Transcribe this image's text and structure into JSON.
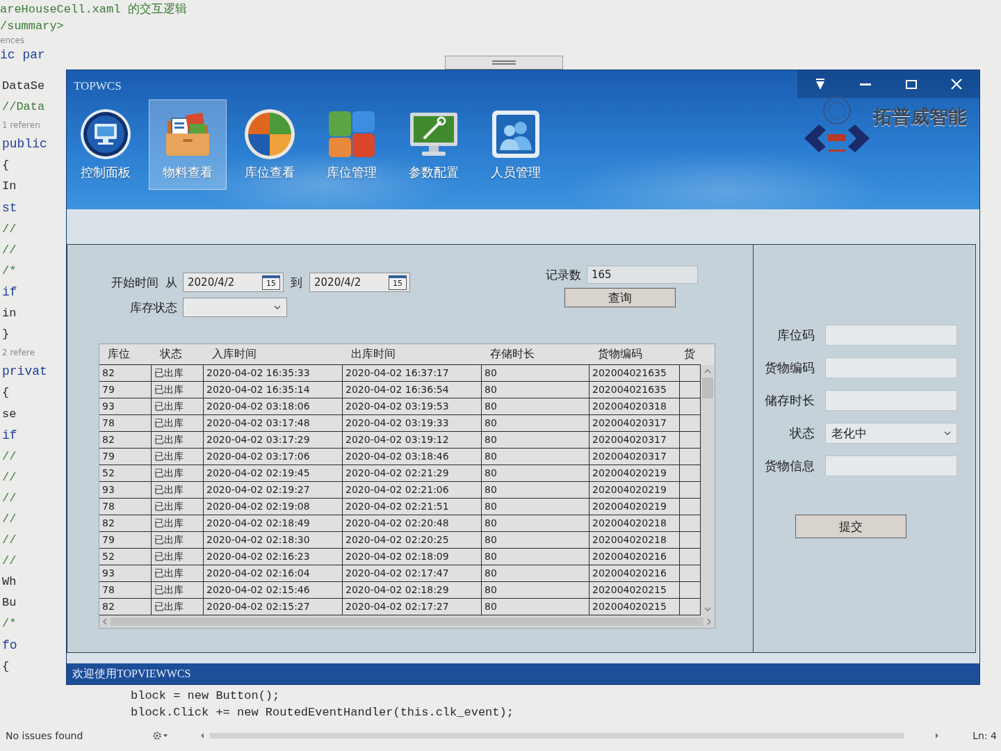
{
  "editor": {
    "top_lines": [
      {
        "kind": "comment",
        "text": "areHouseCell.xaml 的交互逻辑"
      },
      {
        "kind": "comment",
        "text": "/summary>"
      },
      {
        "kind": "ref",
        "text": "ences"
      },
      {
        "kind": "keyword",
        "text": "ic par"
      }
    ],
    "side_lines": [
      {
        "kind": "code",
        "text": "DataSe"
      },
      {
        "kind": "comment",
        "text": "//Data"
      },
      {
        "kind": "ref",
        "text": "1 referen"
      },
      {
        "kind": "keyword",
        "text": "public"
      },
      {
        "kind": "code",
        "text": "{"
      },
      {
        "kind": "code",
        "text": "In"
      },
      {
        "kind": "keyword",
        "text": "st"
      },
      {
        "kind": "comment",
        "text": "//"
      },
      {
        "kind": "comment",
        "text": "//"
      },
      {
        "kind": "comment",
        "text": "/*"
      },
      {
        "kind": "keyword",
        "text": "if"
      },
      {
        "kind": "code",
        "text": "in"
      },
      {
        "kind": "code",
        "text": "}"
      },
      {
        "kind": "ref",
        "text": "2 refere"
      },
      {
        "kind": "keyword",
        "text": "privat"
      },
      {
        "kind": "code",
        "text": "{"
      },
      {
        "kind": "code",
        "text": "se"
      },
      {
        "kind": "keyword",
        "text": "if"
      },
      {
        "kind": "comment",
        "text": "//"
      },
      {
        "kind": "comment",
        "text": "//"
      },
      {
        "kind": "comment",
        "text": "//"
      },
      {
        "kind": "comment",
        "text": "//"
      },
      {
        "kind": "comment",
        "text": "//"
      },
      {
        "kind": "comment",
        "text": "//"
      },
      {
        "kind": "code",
        "text": "Wh"
      },
      {
        "kind": "code",
        "text": "Bu"
      },
      {
        "kind": "comment",
        "text": "/*"
      },
      {
        "kind": "keyword",
        "text": "fo"
      },
      {
        "kind": "code",
        "text": "{"
      }
    ],
    "bottom_lines": [
      {
        "kind": "code",
        "text": "block = new Button();"
      },
      {
        "kind": "code",
        "text": "block.Click += new RoutedEventHandler(this.clk_event);"
      }
    ],
    "status": {
      "message": "No issues found",
      "position": "Ln: 4"
    }
  },
  "window": {
    "title": "TOPWCS",
    "nav": [
      {
        "label": "控制面板",
        "selected": false
      },
      {
        "label": "物料查看",
        "selected": true
      },
      {
        "label": "库位查看",
        "selected": false
      },
      {
        "label": "库位管理",
        "selected": false
      },
      {
        "label": "参数配置",
        "selected": false
      },
      {
        "label": "人员管理",
        "selected": false
      }
    ],
    "logo_text": "拓普威智能"
  },
  "filter": {
    "start_label": "开始时间",
    "from_label": "从",
    "from_date": {
      "value": "2020/4/2",
      "calendar_day": "15"
    },
    "to_label": "到",
    "to_date": {
      "value": "2020/4/2",
      "calendar_day": "15"
    },
    "status_label": "库存状态",
    "count_label": "记录数",
    "count_value": "165",
    "query_button": "查询"
  },
  "table": {
    "columns": [
      "库位",
      "状态",
      "入库时间",
      "出库时间",
      "存储时长",
      "货物编码",
      "货"
    ],
    "rows": [
      [
        "82",
        "已出库",
        "2020-04-02 16:35:33",
        "2020-04-02 16:37:17",
        "80",
        "202004021635"
      ],
      [
        "79",
        "已出库",
        "2020-04-02 16:35:14",
        "2020-04-02 16:36:54",
        "80",
        "202004021635"
      ],
      [
        "93",
        "已出库",
        "2020-04-02 03:18:06",
        "2020-04-02 03:19:53",
        "80",
        "202004020318"
      ],
      [
        "78",
        "已出库",
        "2020-04-02 03:17:48",
        "2020-04-02 03:19:33",
        "80",
        "202004020317"
      ],
      [
        "82",
        "已出库",
        "2020-04-02 03:17:29",
        "2020-04-02 03:19:12",
        "80",
        "202004020317"
      ],
      [
        "79",
        "已出库",
        "2020-04-02 03:17:06",
        "2020-04-02 03:18:46",
        "80",
        "202004020317"
      ],
      [
        "52",
        "已出库",
        "2020-04-02 02:19:45",
        "2020-04-02 02:21:29",
        "80",
        "202004020219"
      ],
      [
        "93",
        "已出库",
        "2020-04-02 02:19:27",
        "2020-04-02 02:21:06",
        "80",
        "202004020219"
      ],
      [
        "78",
        "已出库",
        "2020-04-02 02:19:08",
        "2020-04-02 02:21:51",
        "80",
        "202004020219"
      ],
      [
        "82",
        "已出库",
        "2020-04-02 02:18:49",
        "2020-04-02 02:20:48",
        "80",
        "202004020218"
      ],
      [
        "79",
        "已出库",
        "2020-04-02 02:18:30",
        "2020-04-02 02:20:25",
        "80",
        "202004020218"
      ],
      [
        "52",
        "已出库",
        "2020-04-02 02:16:23",
        "2020-04-02 02:18:09",
        "80",
        "202004020216"
      ],
      [
        "93",
        "已出库",
        "2020-04-02 02:16:04",
        "2020-04-02 02:17:47",
        "80",
        "202004020216"
      ],
      [
        "78",
        "已出库",
        "2020-04-02 02:15:46",
        "2020-04-02 02:18:29",
        "80",
        "202004020215"
      ],
      [
        "82",
        "已出库",
        "2020-04-02 02:15:27",
        "2020-04-02 02:17:27",
        "80",
        "202004020215"
      ]
    ]
  },
  "detail": {
    "fields": [
      {
        "kind": "text",
        "label": "库位码"
      },
      {
        "kind": "text",
        "label": "货物编码"
      },
      {
        "kind": "text",
        "label": "储存时长"
      },
      {
        "kind": "select",
        "label": "状态",
        "value": "老化中"
      },
      {
        "kind": "text",
        "label": "货物信息"
      }
    ],
    "submit_button": "提交"
  },
  "status_bar": {
    "message": "欢迎使用TOPVIEWWCS"
  }
}
